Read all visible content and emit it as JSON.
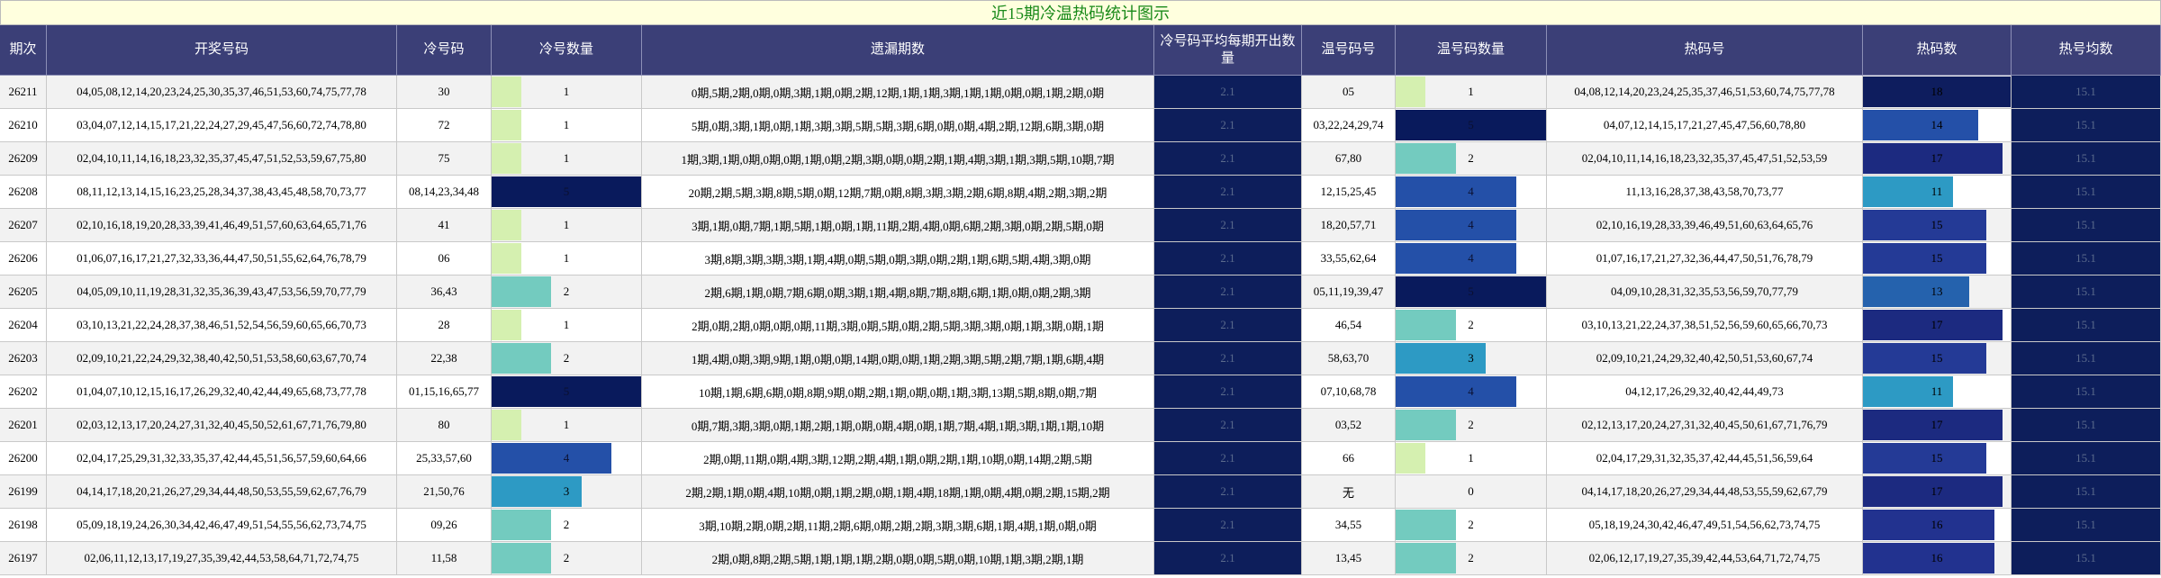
{
  "title": "近15期冷温热码统计图示",
  "chart_data": {
    "type": "table",
    "title": "近15期冷温热码统计图示",
    "columns": [
      "期次",
      "开奖号码",
      "冷号码",
      "冷号数量",
      "遗漏期数",
      "冷号码平均每期开出数量",
      "温号码号",
      "温号码数量",
      "热码号",
      "热码数",
      "热号均数"
    ],
    "count_ranges": {
      "cold": [
        0,
        5
      ],
      "warm": [
        0,
        5
      ],
      "hot": [
        0,
        18
      ]
    },
    "count_colors": {
      "1": "#d5f0b0",
      "2": "#73cbbf",
      "3": "#2d9ac4",
      "4": "#2450a8",
      "5": "#091a5c",
      "11": "#2d9ac4",
      "13": "#2562ad",
      "14": "#2450a8",
      "15": "#243a96",
      "16": "#22328f",
      "17": "#1c2a80",
      "18": "#0e1d5e"
    },
    "rows": [
      {
        "period": "26211",
        "numbers": "04,05,08,12,14,20,23,24,25,30,35,37,46,51,53,60,74,75,77,78",
        "cold": "30",
        "cold_count": 1,
        "omission": "0期,5期,2期,0期,0期,3期,1期,0期,2期,12期,1期,1期,3期,1期,1期,0期,0期,1期,2期,0期",
        "cold_avg": "2.1",
        "warm": "05",
        "warm_count": 1,
        "hot": "04,08,12,14,20,23,24,25,35,37,46,51,53,60,74,75,77,78",
        "hot_count": 18,
        "hot_avg": "15.1"
      },
      {
        "period": "26210",
        "numbers": "03,04,07,12,14,15,17,21,22,24,27,29,45,47,56,60,72,74,78,80",
        "cold": "72",
        "cold_count": 1,
        "omission": "5期,0期,3期,1期,0期,1期,3期,3期,5期,5期,3期,6期,0期,0期,4期,2期,12期,6期,3期,0期",
        "cold_avg": "2.1",
        "warm": "03,22,24,29,74",
        "warm_count": 5,
        "hot": "04,07,12,14,15,17,21,27,45,47,56,60,78,80",
        "hot_count": 14,
        "hot_avg": "15.1"
      },
      {
        "period": "26209",
        "numbers": "02,04,10,11,14,16,18,23,32,35,37,45,47,51,52,53,59,67,75,80",
        "cold": "75",
        "cold_count": 1,
        "omission": "1期,3期,1期,0期,0期,0期,1期,0期,2期,3期,0期,0期,2期,1期,4期,3期,1期,3期,5期,10期,7期",
        "cold_avg": "2.1",
        "warm": "67,80",
        "warm_count": 2,
        "hot": "02,04,10,11,14,16,18,23,32,35,37,45,47,51,52,53,59",
        "hot_count": 17,
        "hot_avg": "15.1"
      },
      {
        "period": "26208",
        "numbers": "08,11,12,13,14,15,16,23,25,28,34,37,38,43,45,48,58,70,73,77",
        "cold": "08,14,23,34,48",
        "cold_count": 5,
        "omission": "20期,2期,5期,3期,8期,5期,0期,12期,7期,0期,8期,3期,3期,2期,6期,8期,4期,2期,3期,2期",
        "cold_avg": "2.1",
        "warm": "12,15,25,45",
        "warm_count": 4,
        "hot": "11,13,16,28,37,38,43,58,70,73,77",
        "hot_count": 11,
        "hot_avg": "15.1"
      },
      {
        "period": "26207",
        "numbers": "02,10,16,18,19,20,28,33,39,41,46,49,51,57,60,63,64,65,71,76",
        "cold": "41",
        "cold_count": 1,
        "omission": "3期,1期,0期,7期,1期,5期,1期,0期,1期,11期,2期,4期,0期,6期,2期,3期,0期,2期,5期,0期",
        "cold_avg": "2.1",
        "warm": "18,20,57,71",
        "warm_count": 4,
        "hot": "02,10,16,19,28,33,39,46,49,51,60,63,64,65,76",
        "hot_count": 15,
        "hot_avg": "15.1"
      },
      {
        "period": "26206",
        "numbers": "01,06,07,16,17,21,27,32,33,36,44,47,50,51,55,62,64,76,78,79",
        "cold": "06",
        "cold_count": 1,
        "omission": "3期,8期,3期,3期,3期,1期,4期,0期,5期,0期,3期,0期,2期,1期,6期,5期,4期,3期,0期",
        "cold_avg": "2.1",
        "warm": "33,55,62,64",
        "warm_count": 4,
        "hot": "01,07,16,17,21,27,32,36,44,47,50,51,76,78,79",
        "hot_count": 15,
        "hot_avg": "15.1"
      },
      {
        "period": "26205",
        "numbers": "04,05,09,10,11,19,28,31,32,35,36,39,43,47,53,56,59,70,77,79",
        "cold": "36,43",
        "cold_count": 2,
        "omission": "2期,6期,1期,0期,7期,6期,0期,3期,1期,4期,8期,7期,8期,6期,1期,0期,0期,2期,3期",
        "cold_avg": "2.1",
        "warm": "05,11,19,39,47",
        "warm_count": 5,
        "hot": "04,09,10,28,31,32,35,53,56,59,70,77,79",
        "hot_count": 13,
        "hot_avg": "15.1"
      },
      {
        "period": "26204",
        "numbers": "03,10,13,21,22,24,28,37,38,46,51,52,54,56,59,60,65,66,70,73",
        "cold": "28",
        "cold_count": 1,
        "omission": "2期,0期,2期,0期,0期,0期,11期,3期,0期,5期,0期,2期,5期,3期,3期,0期,1期,3期,0期,1期",
        "cold_avg": "2.1",
        "warm": "46,54",
        "warm_count": 2,
        "hot": "03,10,13,21,22,24,37,38,51,52,56,59,60,65,66,70,73",
        "hot_count": 17,
        "hot_avg": "15.1"
      },
      {
        "period": "26203",
        "numbers": "02,09,10,21,22,24,29,32,38,40,42,50,51,53,58,60,63,67,70,74",
        "cold": "22,38",
        "cold_count": 2,
        "omission": "1期,4期,0期,3期,9期,1期,0期,0期,14期,0期,0期,1期,2期,3期,5期,2期,7期,1期,6期,4期",
        "cold_avg": "2.1",
        "warm": "58,63,70",
        "warm_count": 3,
        "hot": "02,09,10,21,24,29,32,40,42,50,51,53,60,67,74",
        "hot_count": 15,
        "hot_avg": "15.1"
      },
      {
        "period": "26202",
        "numbers": "01,04,07,10,12,15,16,17,26,29,32,40,42,44,49,65,68,73,77,78",
        "cold": "01,15,16,65,77",
        "cold_count": 5,
        "omission": "10期,1期,6期,6期,0期,8期,9期,0期,2期,1期,0期,0期,1期,3期,13期,5期,8期,0期,7期",
        "cold_avg": "2.1",
        "warm": "07,10,68,78",
        "warm_count": 4,
        "hot": "04,12,17,26,29,32,40,42,44,49,73",
        "hot_count": 11,
        "hot_avg": "15.1"
      },
      {
        "period": "26201",
        "numbers": "02,03,12,13,17,20,24,27,31,32,40,45,50,52,61,67,71,76,79,80",
        "cold": "80",
        "cold_count": 1,
        "omission": "0期,7期,3期,3期,0期,1期,2期,1期,0期,0期,4期,0期,1期,7期,4期,1期,3期,1期,1期,10期",
        "cold_avg": "2.1",
        "warm": "03,52",
        "warm_count": 2,
        "hot": "02,12,13,17,20,24,27,31,32,40,45,50,61,67,71,76,79",
        "hot_count": 17,
        "hot_avg": "15.1"
      },
      {
        "period": "26200",
        "numbers": "02,04,17,25,29,31,32,33,35,37,42,44,45,51,56,57,59,60,64,66",
        "cold": "25,33,57,60",
        "cold_count": 4,
        "omission": "2期,0期,11期,0期,4期,3期,12期,2期,4期,1期,0期,2期,1期,10期,0期,14期,2期,5期",
        "cold_avg": "2.1",
        "warm": "66",
        "warm_count": 1,
        "hot": "02,04,17,29,31,32,35,37,42,44,45,51,56,59,64",
        "hot_count": 15,
        "hot_avg": "15.1"
      },
      {
        "period": "26199",
        "numbers": "04,14,17,18,20,21,26,27,29,34,44,48,50,53,55,59,62,67,76,79",
        "cold": "21,50,76",
        "cold_count": 3,
        "omission": "2期,2期,1期,0期,4期,10期,0期,1期,2期,0期,1期,4期,18期,1期,0期,4期,0期,2期,15期,2期",
        "cold_avg": "2.1",
        "warm": "无",
        "warm_count": 0,
        "hot": "04,14,17,18,20,26,27,29,34,44,48,53,55,59,62,67,79",
        "hot_count": 17,
        "hot_avg": "15.1"
      },
      {
        "period": "26198",
        "numbers": "05,09,18,19,24,26,30,34,42,46,47,49,51,54,55,56,62,73,74,75",
        "cold": "09,26",
        "cold_count": 2,
        "omission": "3期,10期,2期,0期,2期,11期,2期,6期,0期,2期,2期,3期,3期,6期,1期,4期,1期,0期,0期",
        "cold_avg": "2.1",
        "warm": "34,55",
        "warm_count": 2,
        "hot": "05,18,19,24,30,42,46,47,49,51,54,56,62,73,74,75",
        "hot_count": 16,
        "hot_avg": "15.1"
      },
      {
        "period": "26197",
        "numbers": "02,06,11,12,13,17,19,27,35,39,42,44,53,58,64,71,72,74,75",
        "cold": "11,58",
        "cold_count": 2,
        "omission": "2期,0期,8期,2期,5期,1期,1期,1期,2期,0期,0期,5期,0期,10期,1期,3期,2期,1期",
        "cold_avg": "2.1",
        "warm": "13,45",
        "warm_count": 2,
        "hot": "02,06,12,17,19,27,35,39,42,44,53,64,71,72,74,75",
        "hot_count": 16,
        "hot_avg": "15.1"
      }
    ]
  }
}
